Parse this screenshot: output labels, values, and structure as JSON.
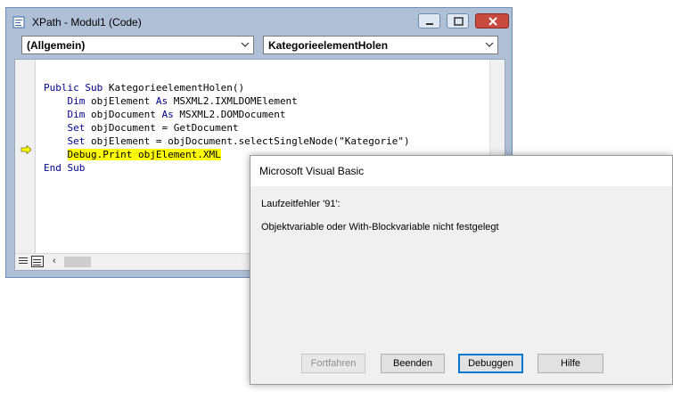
{
  "vbe": {
    "title": "XPath - Modul1 (Code)",
    "object_combo": "(Allgemein)",
    "procedure_combo": "KategorieelementHolen",
    "code_lines": [
      {
        "indent": "",
        "parts": [
          {
            "t": "Public Sub",
            "kw": true
          },
          {
            "t": " KategorieelementHolen()",
            "kw": false
          }
        ],
        "highlight": false
      },
      {
        "indent": "    ",
        "parts": [
          {
            "t": "Dim",
            "kw": true
          },
          {
            "t": " objElement ",
            "kw": false
          },
          {
            "t": "As",
            "kw": true
          },
          {
            "t": " MSXML2.IXMLDOMElement",
            "kw": false
          }
        ],
        "highlight": false
      },
      {
        "indent": "    ",
        "parts": [
          {
            "t": "Dim",
            "kw": true
          },
          {
            "t": " objDocument ",
            "kw": false
          },
          {
            "t": "As",
            "kw": true
          },
          {
            "t": " MSXML2.DOMDocument",
            "kw": false
          }
        ],
        "highlight": false
      },
      {
        "indent": "    ",
        "parts": [
          {
            "t": "Set",
            "kw": true
          },
          {
            "t": " objDocument = GetDocument",
            "kw": false
          }
        ],
        "highlight": false
      },
      {
        "indent": "    ",
        "parts": [
          {
            "t": "Set",
            "kw": true
          },
          {
            "t": " objElement = objDocument.selectSingleNode(\"Kategorie\")",
            "kw": false
          }
        ],
        "highlight": false
      },
      {
        "indent": "    ",
        "parts": [
          {
            "t": "Debug.Print objElement.XML",
            "kw": false
          }
        ],
        "highlight": true
      },
      {
        "indent": "",
        "parts": [
          {
            "t": "End Sub",
            "kw": true
          }
        ],
        "highlight": false
      }
    ],
    "icons": {
      "app": "vba-code-window-icon",
      "exec": "execution-arrow-icon"
    }
  },
  "dialog": {
    "title": "Microsoft Visual Basic",
    "error_line": "Laufzeitfehler '91':",
    "message": "Objektvariable oder With-Blockvariable nicht festgelegt",
    "buttons": {
      "continue": "Fortfahren",
      "end": "Beenden",
      "debug": "Debuggen",
      "help": "Hilfe"
    }
  },
  "colors": {
    "highlight": "#ffff00",
    "keyword": "#00008b",
    "exec_arrow": "#ffff00"
  }
}
